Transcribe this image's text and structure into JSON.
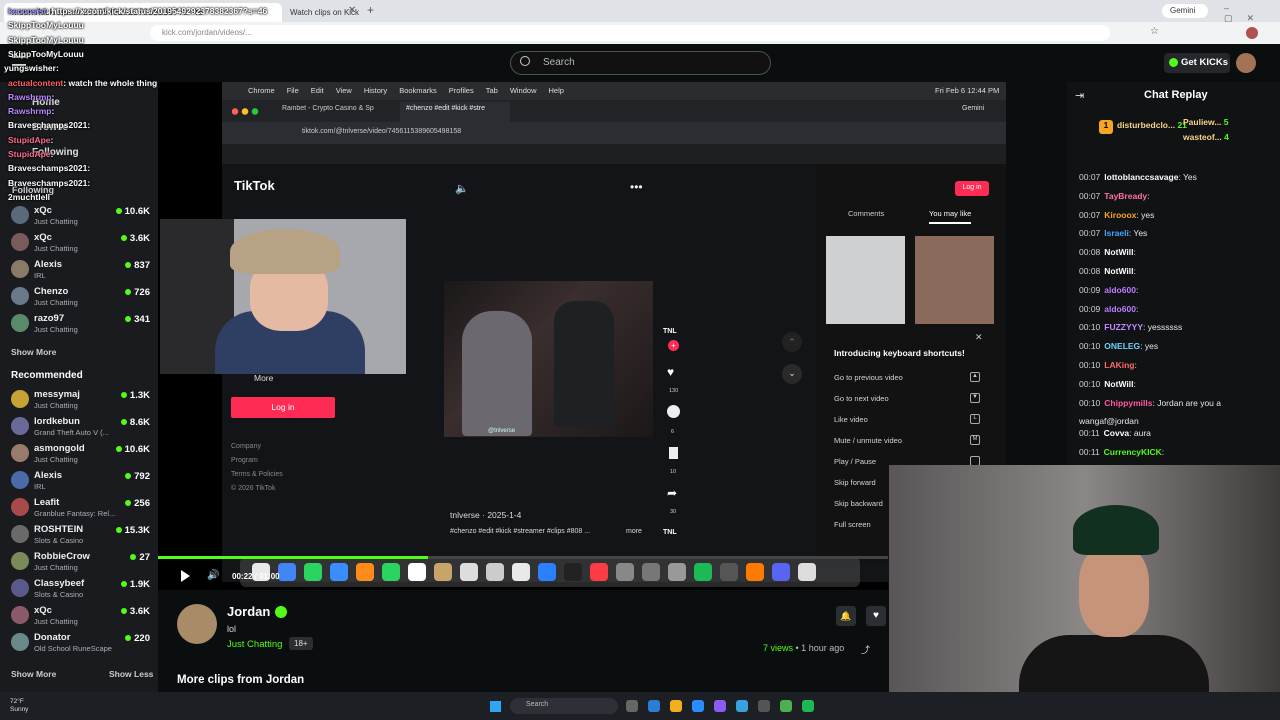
{
  "browser": {
    "tab1": "x.com/kick/status/2019549292378382367?s=46",
    "tab2": "Watch clips on Kick",
    "url": "kick.com/jordan/videos/...",
    "gemini": "Gemini"
  },
  "header": {
    "search_placeholder": "Search",
    "get_kicks": "Get KICKs"
  },
  "overlay_chat": [
    {
      "user": "kecccsist",
      "text": ": https://x.com/kick/status/2019549292378382367?s=46",
      "color": "#9f9fff"
    },
    {
      "user": "SkippTooMyLouuu",
      "text": "",
      "color": "#ffffff"
    },
    {
      "user": "SkippTooMyLouuu",
      "text": "",
      "color": "#ffffff"
    },
    {
      "user": "SkippTooMyLouuu",
      "text": "",
      "color": "#ffffff"
    },
    {
      "user": "yungswisher",
      "text": ": ",
      "color": "#ffffff"
    },
    {
      "user": "actualcontent",
      "text": ": watch the whole thing",
      "color": "#ff5f5f"
    },
    {
      "user": "Rawshrmp",
      "text": ":",
      "color": "#b98aff"
    },
    {
      "user": "Rawshrmp",
      "text": ":",
      "color": "#b98aff"
    },
    {
      "user": "Braveschamps2021",
      "text": ":",
      "color": "#ffffff"
    },
    {
      "user": "StupidApe",
      "text": ":",
      "color": "#ff6b8a"
    },
    {
      "user": "StupidApe",
      "text": ":",
      "color": "#ff6b8a"
    },
    {
      "user": "Braveschamps2021",
      "text": ":",
      "color": "#ffffff"
    },
    {
      "user": "Braveschamps2021",
      "text": ":",
      "color": "#ffffff"
    },
    {
      "user": "2muchtlell",
      "text": "",
      "color": "#ffffff"
    }
  ],
  "sidebar": {
    "home": "Home",
    "browse": "Browse",
    "following_heading": "Following",
    "following": [
      {
        "name": "xQc",
        "cat": "Just Chatting",
        "count": "10.6K"
      },
      {
        "name": "xQc",
        "cat": "Just Chatting",
        "count": "3.6K"
      },
      {
        "name": "Alexis",
        "cat": "IRL",
        "count": "837"
      },
      {
        "name": "Chenzo",
        "cat": "Just Chatting",
        "count": "726"
      },
      {
        "name": "razo97",
        "cat": "Just Chatting",
        "count": "341"
      }
    ],
    "show_more": "Show More",
    "recommended_heading": "Recommended",
    "recommended": [
      {
        "name": "messymaj",
        "cat": "Just Chatting",
        "count": "1.3K"
      },
      {
        "name": "lordkebun",
        "cat": "Grand Theft Auto V (...",
        "count": "8.6K"
      },
      {
        "name": "asmongold",
        "cat": "Just Chatting",
        "count": "10.6K"
      },
      {
        "name": "Alexis",
        "cat": "IRL",
        "count": "792"
      },
      {
        "name": "Leafit",
        "cat": "Granblue Fantasy: Rel...",
        "count": "256"
      },
      {
        "name": "ROSHTEIN",
        "cat": "Slots & Casino",
        "count": "15.3K"
      },
      {
        "name": "RobbieCrow",
        "cat": "Just Chatting",
        "count": "27"
      },
      {
        "name": "Classybeef",
        "cat": "Slots & Casino",
        "count": "1.9K"
      },
      {
        "name": "xQc",
        "cat": "Just Chatting",
        "count": "3.6K"
      },
      {
        "name": "Donator",
        "cat": "Old School RuneScape",
        "count": "220"
      }
    ],
    "show_more2": "Show More",
    "show_less": "Show Less"
  },
  "mac": {
    "menu": [
      "Chrome",
      "File",
      "Edit",
      "View",
      "History",
      "Bookmarks",
      "Profiles",
      "Tab",
      "Window",
      "Help"
    ],
    "clock": "Fri Feb 6 12:44 PM",
    "tab1": "Rainbet - Crypto Casino & Sp",
    "tab2": "#chenzo #edit #kick #stre",
    "url": "tiktok.com/@tnlverse/video/7456115389605498158",
    "gemini": "Gemini"
  },
  "tiktok": {
    "logo": "TikTok",
    "login": "Log in",
    "login2": "Log in",
    "more": "More",
    "footer": [
      "Company",
      "Program",
      "Terms & Policies",
      "© 2026 TikTok"
    ],
    "tab_comments": "Comments",
    "tab_may_like": "You may like",
    "author": "tnlverse",
    "date": "2025-1-4",
    "tags": "#chenzo #edit #kick #streamer #clips #808 ...",
    "more_link": "more",
    "tnl": "TNL",
    "counts": [
      "130",
      "6",
      "10",
      "30"
    ],
    "kb_title": "Introducing keyboard shortcuts!",
    "kb": [
      "Go to previous video",
      "Go to next video",
      "Like video",
      "Mute / unmute video",
      "Play / Pause",
      "Skip forward",
      "Skip backward",
      "Full screen"
    ],
    "kb_keys": [
      "▲",
      "▼",
      "L",
      "M",
      "",
      "",
      "",
      ""
    ],
    "watermark": "@tnlverse"
  },
  "player": {
    "time": "00:22 / 01:00",
    "progress": 0.37
  },
  "stream": {
    "name": "Jordan",
    "title": "lol",
    "category": "Just Chatting",
    "badge": "18+",
    "views": "7 views",
    "ago": "• 1 hour ago",
    "more_clips": "More clips from Jordan"
  },
  "chat": {
    "title": "Chat Replay",
    "top": [
      {
        "rank": "1",
        "name": "disturbedclo...",
        "num": "21"
      },
      {
        "rank": "",
        "name": "Pauliew...",
        "num": "5"
      },
      {
        "rank": "",
        "name": "wasteof...",
        "num": "4"
      }
    ],
    "messages": [
      {
        "t": "00:07",
        "u": "lottoblanccsavage",
        "m": ": Yes",
        "c": "#ffffff"
      },
      {
        "t": "00:07",
        "u": "TayBready",
        "m": ":",
        "c": "#ff6fa6"
      },
      {
        "t": "00:07",
        "u": "Kirooox",
        "m": ": yes",
        "c": "#f5a623"
      },
      {
        "t": "00:07",
        "u": "Israeli",
        "m": ": Yes",
        "c": "#4aa3ff"
      },
      {
        "t": "00:08",
        "u": "NotWill",
        "m": ":",
        "c": "#ffffff"
      },
      {
        "t": "00:08",
        "u": "NotWill",
        "m": ":",
        "c": "#ffffff"
      },
      {
        "t": "00:09",
        "u": "aldo600",
        "m": ":",
        "c": "#bb7bff"
      },
      {
        "t": "00:09",
        "u": "aldo600",
        "m": ":",
        "c": "#bb7bff"
      },
      {
        "t": "00:10",
        "u": "FUZZYYY",
        "m": ": yessssss",
        "c": "#c18bff"
      },
      {
        "t": "00:10",
        "u": "ONELEG",
        "m": ": yes",
        "c": "#6fd0ff"
      },
      {
        "t": "00:10",
        "u": "LAKing",
        "m": ":",
        "c": "#ff6b6b"
      },
      {
        "t": "00:10",
        "u": "NotWill",
        "m": ":",
        "c": "#ffffff"
      },
      {
        "t": "00:10",
        "u": "Chippymills",
        "m": ": Jordan are you a",
        "c": "#ff5aa0"
      },
      {
        "t": "",
        "u": "",
        "m": "wangaf@jordan",
        "c": "#ffffff"
      },
      {
        "t": "00:11",
        "u": "Covva",
        "m": ": aura",
        "c": "#ffffff"
      },
      {
        "t": "00:11",
        "u": "CurrencyKICK",
        "m": ":",
        "c": "#53fc18"
      }
    ]
  },
  "taskbar": {
    "search": "Search",
    "weather": "Sunny",
    "temp": "72°F"
  },
  "colors": {
    "kick_green": "#53fc18",
    "tiktok_red": "#fe2c55"
  }
}
